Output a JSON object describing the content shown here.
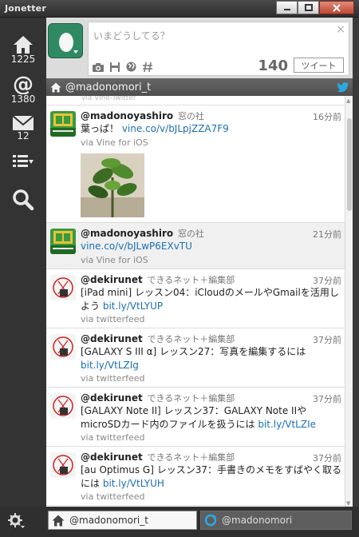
{
  "window": {
    "title": "Jonetter",
    "controls": [
      "minimize",
      "maximize",
      "close"
    ]
  },
  "sidebar": {
    "items": [
      {
        "name": "home",
        "icon": "home-icon",
        "count": "1225"
      },
      {
        "name": "mentions",
        "icon": "at-icon",
        "count": "1380"
      },
      {
        "name": "messages",
        "icon": "envelope-icon",
        "count": "12"
      },
      {
        "name": "lists",
        "icon": "list-icon",
        "count": ""
      },
      {
        "name": "search",
        "icon": "search-icon",
        "count": ""
      }
    ]
  },
  "compose": {
    "placeholder": "いまどうしてる？",
    "char_count": "140",
    "tweet_button": "ツイート",
    "icons": [
      "camera-icon",
      "save-icon",
      "globe-icon",
      "hash-icon"
    ]
  },
  "column": {
    "title": "@madonomori_t"
  },
  "timeline": {
    "peek_text": "via Vine-Twitter",
    "tweets": [
      {
        "user": "@madonoyashiro",
        "display": "窓の社",
        "time": "16分前",
        "text_pre": "葉っぱ！ ",
        "link": "vine.co/v/bJLpjZZA7F9",
        "text_post": "",
        "via": "via Vine for iOS"
      },
      {
        "user": "@madonoyashiro",
        "display": "窓の社",
        "time": "21分前",
        "text_pre": "",
        "link": "vine.co/v/bJLwP6EXvTU",
        "text_post": "",
        "via": "via Vine for iOS"
      },
      {
        "user": "@dekirunet",
        "display": "できるネット＋編集部",
        "time": "37分前",
        "text_pre": "[iPad mini] レッスン04：iCloudのメールやGmailを活用しよう ",
        "link": "bit.ly/VtLYUP",
        "text_post": "",
        "via": "via twitterfeed"
      },
      {
        "user": "@dekirunet",
        "display": "できるネット＋編集部",
        "time": "37分前",
        "text_pre": "[GALAXY S III α] レッスン27：写真を編集するには ",
        "link": "bit.ly/VtLZIg",
        "text_post": "",
        "via": "via twitterfeed"
      },
      {
        "user": "@dekirunet",
        "display": "できるネット＋編集部",
        "time": "37分前",
        "text_pre": "[GALAXY Note II] レッスン37：GALAXY Note IIやmicroSDカード内のファイルを扱うには ",
        "link": "bit.ly/VtLZIe",
        "text_post": "",
        "via": "via twitterfeed"
      },
      {
        "user": "@dekirunet",
        "display": "できるネット＋編集部",
        "time": "37分前",
        "text_pre": "[au Optimus G] レッスン37：手書きのメモをすばやく取るには ",
        "link": "bit.ly/VtLYUH",
        "text_post": "",
        "via": "via twitterfeed"
      }
    ]
  },
  "bottom_tabs": [
    {
      "label": "@madonomori_t",
      "icon": "home-icon",
      "active": true
    },
    {
      "label": "@madonomori",
      "icon": "refresh-icon",
      "active": false
    }
  ],
  "colors": {
    "link": "#1a6fb5",
    "sidebar": "#333333",
    "egg_avatar": "#2f8a63",
    "twitter_bird": "#2aa9e0"
  }
}
